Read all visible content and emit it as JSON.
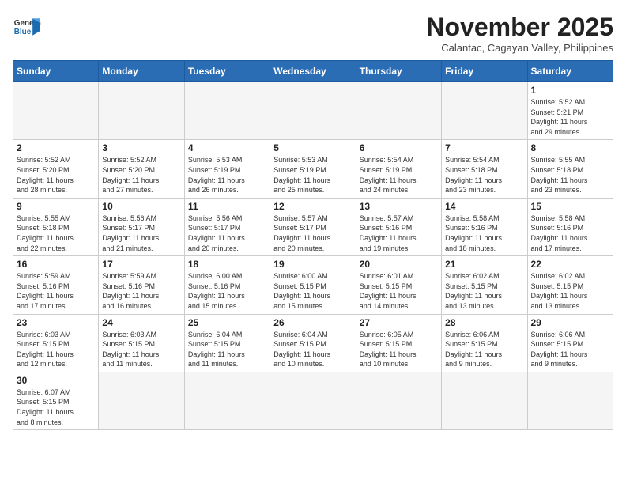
{
  "header": {
    "logo_general": "General",
    "logo_blue": "Blue",
    "month_title": "November 2025",
    "subtitle": "Calantac, Cagayan Valley, Philippines"
  },
  "days_of_week": [
    "Sunday",
    "Monday",
    "Tuesday",
    "Wednesday",
    "Thursday",
    "Friday",
    "Saturday"
  ],
  "weeks": [
    [
      {
        "day": "",
        "info": ""
      },
      {
        "day": "",
        "info": ""
      },
      {
        "day": "",
        "info": ""
      },
      {
        "day": "",
        "info": ""
      },
      {
        "day": "",
        "info": ""
      },
      {
        "day": "",
        "info": ""
      },
      {
        "day": "1",
        "info": "Sunrise: 5:52 AM\nSunset: 5:21 PM\nDaylight: 11 hours\nand 29 minutes."
      }
    ],
    [
      {
        "day": "2",
        "info": "Sunrise: 5:52 AM\nSunset: 5:20 PM\nDaylight: 11 hours\nand 28 minutes."
      },
      {
        "day": "3",
        "info": "Sunrise: 5:52 AM\nSunset: 5:20 PM\nDaylight: 11 hours\nand 27 minutes."
      },
      {
        "day": "4",
        "info": "Sunrise: 5:53 AM\nSunset: 5:19 PM\nDaylight: 11 hours\nand 26 minutes."
      },
      {
        "day": "5",
        "info": "Sunrise: 5:53 AM\nSunset: 5:19 PM\nDaylight: 11 hours\nand 25 minutes."
      },
      {
        "day": "6",
        "info": "Sunrise: 5:54 AM\nSunset: 5:19 PM\nDaylight: 11 hours\nand 24 minutes."
      },
      {
        "day": "7",
        "info": "Sunrise: 5:54 AM\nSunset: 5:18 PM\nDaylight: 11 hours\nand 23 minutes."
      },
      {
        "day": "8",
        "info": "Sunrise: 5:55 AM\nSunset: 5:18 PM\nDaylight: 11 hours\nand 23 minutes."
      }
    ],
    [
      {
        "day": "9",
        "info": "Sunrise: 5:55 AM\nSunset: 5:18 PM\nDaylight: 11 hours\nand 22 minutes."
      },
      {
        "day": "10",
        "info": "Sunrise: 5:56 AM\nSunset: 5:17 PM\nDaylight: 11 hours\nand 21 minutes."
      },
      {
        "day": "11",
        "info": "Sunrise: 5:56 AM\nSunset: 5:17 PM\nDaylight: 11 hours\nand 20 minutes."
      },
      {
        "day": "12",
        "info": "Sunrise: 5:57 AM\nSunset: 5:17 PM\nDaylight: 11 hours\nand 20 minutes."
      },
      {
        "day": "13",
        "info": "Sunrise: 5:57 AM\nSunset: 5:16 PM\nDaylight: 11 hours\nand 19 minutes."
      },
      {
        "day": "14",
        "info": "Sunrise: 5:58 AM\nSunset: 5:16 PM\nDaylight: 11 hours\nand 18 minutes."
      },
      {
        "day": "15",
        "info": "Sunrise: 5:58 AM\nSunset: 5:16 PM\nDaylight: 11 hours\nand 17 minutes."
      }
    ],
    [
      {
        "day": "16",
        "info": "Sunrise: 5:59 AM\nSunset: 5:16 PM\nDaylight: 11 hours\nand 17 minutes."
      },
      {
        "day": "17",
        "info": "Sunrise: 5:59 AM\nSunset: 5:16 PM\nDaylight: 11 hours\nand 16 minutes."
      },
      {
        "day": "18",
        "info": "Sunrise: 6:00 AM\nSunset: 5:16 PM\nDaylight: 11 hours\nand 15 minutes."
      },
      {
        "day": "19",
        "info": "Sunrise: 6:00 AM\nSunset: 5:15 PM\nDaylight: 11 hours\nand 15 minutes."
      },
      {
        "day": "20",
        "info": "Sunrise: 6:01 AM\nSunset: 5:15 PM\nDaylight: 11 hours\nand 14 minutes."
      },
      {
        "day": "21",
        "info": "Sunrise: 6:02 AM\nSunset: 5:15 PM\nDaylight: 11 hours\nand 13 minutes."
      },
      {
        "day": "22",
        "info": "Sunrise: 6:02 AM\nSunset: 5:15 PM\nDaylight: 11 hours\nand 13 minutes."
      }
    ],
    [
      {
        "day": "23",
        "info": "Sunrise: 6:03 AM\nSunset: 5:15 PM\nDaylight: 11 hours\nand 12 minutes."
      },
      {
        "day": "24",
        "info": "Sunrise: 6:03 AM\nSunset: 5:15 PM\nDaylight: 11 hours\nand 11 minutes."
      },
      {
        "day": "25",
        "info": "Sunrise: 6:04 AM\nSunset: 5:15 PM\nDaylight: 11 hours\nand 11 minutes."
      },
      {
        "day": "26",
        "info": "Sunrise: 6:04 AM\nSunset: 5:15 PM\nDaylight: 11 hours\nand 10 minutes."
      },
      {
        "day": "27",
        "info": "Sunrise: 6:05 AM\nSunset: 5:15 PM\nDaylight: 11 hours\nand 10 minutes."
      },
      {
        "day": "28",
        "info": "Sunrise: 6:06 AM\nSunset: 5:15 PM\nDaylight: 11 hours\nand 9 minutes."
      },
      {
        "day": "29",
        "info": "Sunrise: 6:06 AM\nSunset: 5:15 PM\nDaylight: 11 hours\nand 9 minutes."
      }
    ],
    [
      {
        "day": "30",
        "info": "Sunrise: 6:07 AM\nSunset: 5:15 PM\nDaylight: 11 hours\nand 8 minutes."
      },
      {
        "day": "",
        "info": ""
      },
      {
        "day": "",
        "info": ""
      },
      {
        "day": "",
        "info": ""
      },
      {
        "day": "",
        "info": ""
      },
      {
        "day": "",
        "info": ""
      },
      {
        "day": "",
        "info": ""
      }
    ]
  ]
}
